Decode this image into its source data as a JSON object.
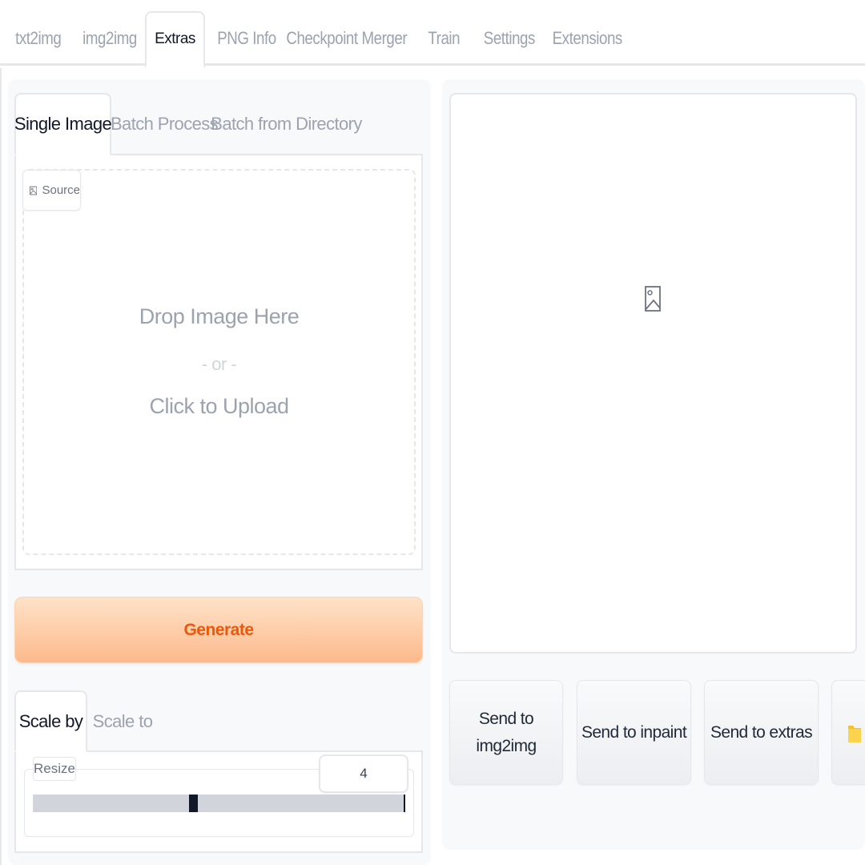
{
  "top_tabs": [
    "txt2img",
    "img2img",
    "Extras",
    "PNG Info",
    "Checkpoint Merger",
    "Train",
    "Settings",
    "Extensions"
  ],
  "active_top_tab": "Extras",
  "mode_tabs": [
    "Single Image",
    "Batch Process",
    "Batch from Directory"
  ],
  "active_mode_tab": "Single Image",
  "source": {
    "label": "Source",
    "drop_text": "Drop Image Here",
    "or_text": "- or -",
    "upload_text": "Click to Upload"
  },
  "generate_label": "Generate",
  "scale_tabs": [
    "Scale by",
    "Scale to"
  ],
  "active_scale_tab": "Scale by",
  "resize": {
    "label": "Resize",
    "value": "4",
    "slider_fraction": 0.43
  },
  "output_buttons": [
    "Send to img2img",
    "Send to inpaint",
    "Send to extras"
  ],
  "colors": {
    "accent": "#ea580c",
    "generate_bg_top": "#fee2c9",
    "generate_bg_bottom": "#fdba8c",
    "folder_icon": "#fbbf24"
  }
}
